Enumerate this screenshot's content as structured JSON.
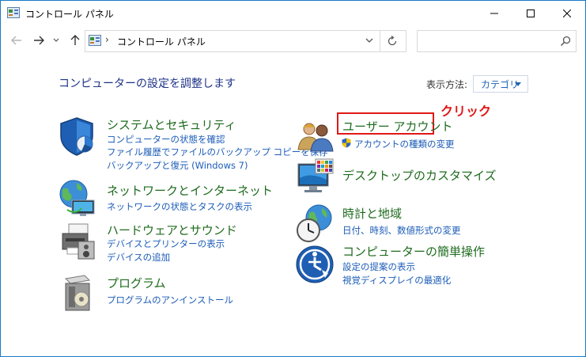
{
  "window": {
    "title": "コントロール パネル"
  },
  "address": {
    "path": "コントロール パネル",
    "separator": "›"
  },
  "search": {
    "placeholder": ""
  },
  "main": {
    "heading": "コンピューターの設定を調整します",
    "view_by_label": "表示方法:",
    "view_by_value": "カテゴリ"
  },
  "categories": [
    {
      "title": "システムとセキュリティ",
      "links": [
        "コンピューターの状態を確認",
        "ファイル履歴でファイルのバックアップ コピーを保存",
        "バックアップと復元 (Windows 7)"
      ]
    },
    {
      "title": "ネットワークとインターネット",
      "links": [
        "ネットワークの状態とタスクの表示"
      ]
    },
    {
      "title": "ハードウェアとサウンド",
      "links": [
        "デバイスとプリンターの表示",
        "デバイスの追加"
      ]
    },
    {
      "title": "プログラム",
      "links": [
        "プログラムのアンインストール"
      ]
    },
    {
      "title": "ユーザー アカウント",
      "links": [
        "アカウントの種類の変更"
      ]
    },
    {
      "title": "デスクトップのカスタマイズ",
      "links": []
    },
    {
      "title": "時計と地域",
      "links": [
        "日付、時刻、数値形式の変更"
      ]
    },
    {
      "title": "コンピューターの簡単操作",
      "links": [
        "設定の提案の表示",
        "視覚ディスプレイの最適化"
      ]
    }
  ],
  "annotation": {
    "text": "クリック",
    "color": "#e01818"
  },
  "colors": {
    "accent": "#1979ca",
    "category_title": "#1e6b1e",
    "link": "#1c5cb8",
    "heading": "#1e3287"
  },
  "icons": [
    "control-panel-icon",
    "back-arrow-icon",
    "forward-arrow-icon",
    "recent-dropdown-icon",
    "up-arrow-icon",
    "refresh-icon",
    "search-icon",
    "minimize-icon",
    "maximize-icon",
    "close-icon",
    "shield-icon",
    "globe-network-icon",
    "printer-icon",
    "programs-box-icon",
    "users-icon",
    "uac-shield-icon",
    "monitor-palette-icon",
    "clock-globe-icon",
    "ease-of-access-icon"
  ]
}
